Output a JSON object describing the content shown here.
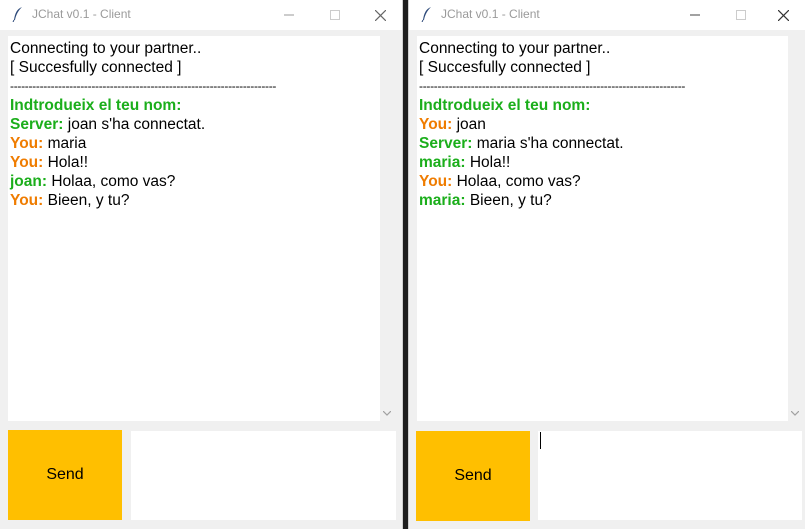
{
  "colors": {
    "send_button": "#ffbf00",
    "speaker_green": "#1bae1b",
    "speaker_orange": "#ef7c00"
  },
  "windows": [
    {
      "title": "JChat v0.1 - Client",
      "send_label": "Send",
      "messages": [
        {
          "speaker": "",
          "text": "Connecting to your partner.."
        },
        {
          "speaker": "",
          "text": "[ Succesfully connected ]"
        },
        {
          "speaker": "",
          "text": "------------------------------------------------------------------------"
        },
        {
          "speaker": "Indtrodueix el teu nom:",
          "text": ""
        },
        {
          "speaker": "Server:",
          "text": "joan s'ha connectat."
        },
        {
          "speaker": "You:",
          "text": "maria"
        },
        {
          "speaker": "You:",
          "text": "Hola!!"
        },
        {
          "speaker": "joan:",
          "text": "Holaa, como vas?"
        },
        {
          "speaker": "You:",
          "text": "Bieen, y tu?"
        }
      ]
    },
    {
      "title": "JChat v0.1 - Client",
      "send_label": "Send",
      "messages": [
        {
          "speaker": "",
          "text": "Connecting to your partner.."
        },
        {
          "speaker": "",
          "text": "[ Succesfully connected ]"
        },
        {
          "speaker": "",
          "text": "------------------------------------------------------------------------"
        },
        {
          "speaker": "Indtrodueix el teu nom:",
          "text": ""
        },
        {
          "speaker": "You:",
          "text": "joan"
        },
        {
          "speaker": "Server:",
          "text": "maria s'ha connectat."
        },
        {
          "speaker": "maria:",
          "text": "Hola!!"
        },
        {
          "speaker": "You:",
          "text": "Holaa, como vas?"
        },
        {
          "speaker": "maria:",
          "text": "Bieen, y tu?"
        }
      ]
    }
  ]
}
